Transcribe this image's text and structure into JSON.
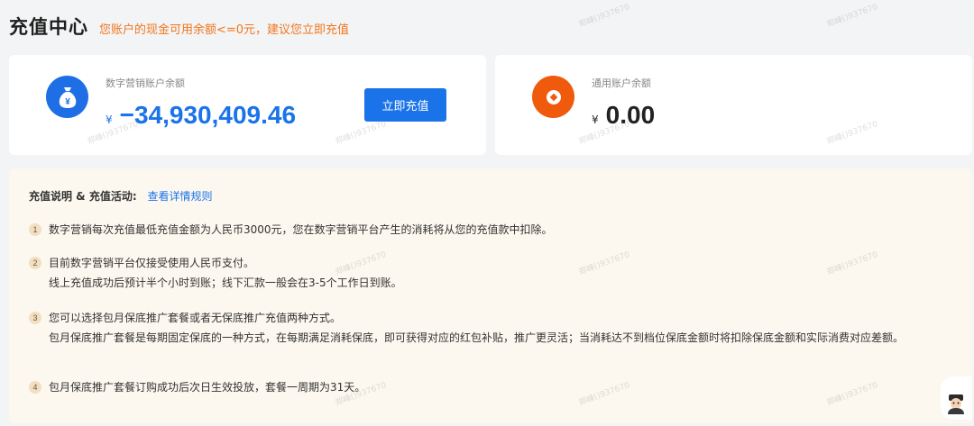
{
  "header": {
    "title": "充值中心",
    "warning": "您账户的现金可用余额<=0元，建议您立即充值"
  },
  "digital_account": {
    "label": "数字营销账户余额",
    "currency": "¥",
    "amount": "−34,930,409.46",
    "button_label": "立即充值",
    "icon": "money-bag-icon"
  },
  "general_account": {
    "label": "通用账户余额",
    "currency": "¥",
    "amount": "0.00",
    "icon": "coin-icon"
  },
  "info": {
    "heading_label": "充值说明 & 充值活动:",
    "details_link": "查看详情规则",
    "steps": [
      {
        "num": "1",
        "text": "数字营销每次充值最低充值金额为人民币3000元，您在数字营销平台产生的消耗将从您的充值款中扣除。"
      },
      {
        "num": "2",
        "text": "目前数字营销平台仅接受使用人民币支付。",
        "sub": "线上充值成功后预计半个小时到账；线下汇款一般会在3-5个工作日到账。"
      },
      {
        "num": "3",
        "text": "您可以选择包月保底推广套餐或者无保底推广充值两种方式。",
        "sub": "包月保底推广套餐是每期固定保底的一种方式，在每期满足消耗保底，即可获得对应的红包补贴，推广更灵活；当消耗达不到档位保底金额时将扣除保底金额和实际消费对应差额。"
      },
      {
        "num": "4",
        "text": "包月保底推广套餐订购成功后次日生效投放，套餐一周期为31天。"
      }
    ]
  },
  "watermark_text": "郑峰()937670",
  "colors": {
    "accent_blue": "#1a73e8",
    "warning_orange": "#f2761c",
    "icon_orange": "#f05a0c",
    "panel_bg": "#fdf8ef"
  }
}
